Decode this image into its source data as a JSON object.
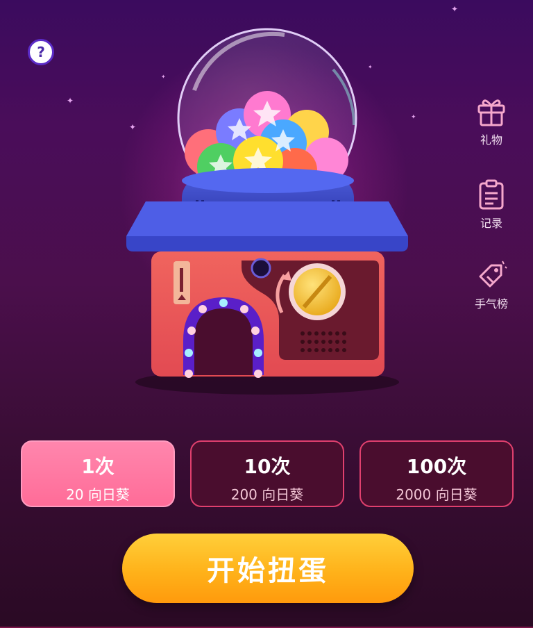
{
  "side_menu": [
    {
      "label": "礼物",
      "icon": "gift-icon"
    },
    {
      "label": "记录",
      "icon": "clipboard-icon"
    },
    {
      "label": "手气榜",
      "icon": "tag-icon"
    }
  ],
  "options": [
    {
      "count": "1次",
      "cost": "20 向日葵",
      "selected": true
    },
    {
      "count": "10次",
      "cost": "200 向日葵",
      "selected": false
    },
    {
      "count": "100次",
      "cost": "2000 向日葵",
      "selected": false
    }
  ],
  "start_button": {
    "label": "开始扭蛋"
  },
  "help_button": {
    "symbol": "?"
  },
  "colors": {
    "accent_pink": "#ff6c98",
    "button_orange": "#ffb21a",
    "card_border": "#e0406e",
    "background": "#4a0d5a"
  }
}
